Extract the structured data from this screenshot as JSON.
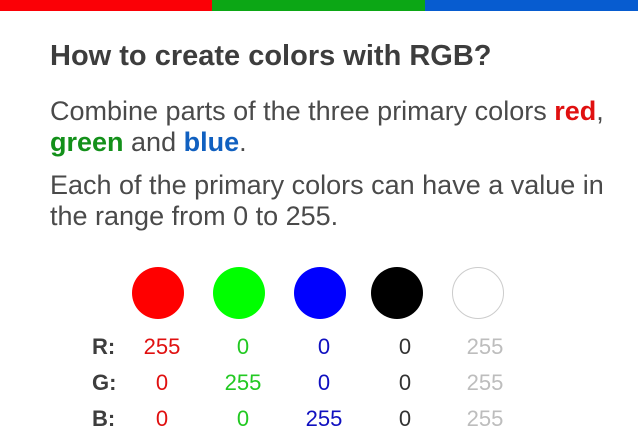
{
  "colors": {
    "red": "#fb0006",
    "green": "#0ca715",
    "blue": "#075cd0",
    "swatch_red": "#ff0000",
    "swatch_green": "#00ff00",
    "swatch_blue": "#0000ff",
    "swatch_black": "#000000",
    "swatch_white": "#ffffff",
    "swatch_white_border": "#cccccc"
  },
  "title": "How to create colors with RGB?",
  "para1": {
    "before": "Combine parts of the three primary colors ",
    "red": "red",
    "sep1": ", ",
    "green": "green",
    "mid": " and ",
    "blue": "blue",
    "end": "."
  },
  "para2": "Each of the primary colors can have a value in the range from 0 to 255.",
  "table": {
    "labels": [
      "R:",
      "G:",
      "B:"
    ],
    "swatches": [
      {
        "name": "red",
        "r": "255",
        "g": "0",
        "b": "0",
        "text_color": "#e01010"
      },
      {
        "name": "green",
        "r": "0",
        "g": "255",
        "b": "0",
        "text_color": "#22c922"
      },
      {
        "name": "blue",
        "r": "0",
        "g": "0",
        "b": "255",
        "text_color": "#1010c0"
      },
      {
        "name": "black",
        "r": "0",
        "g": "0",
        "b": "0",
        "text_color": "#333333"
      },
      {
        "name": "white",
        "r": "255",
        "g": "255",
        "b": "255",
        "text_color": "#bdbdbd"
      }
    ]
  }
}
